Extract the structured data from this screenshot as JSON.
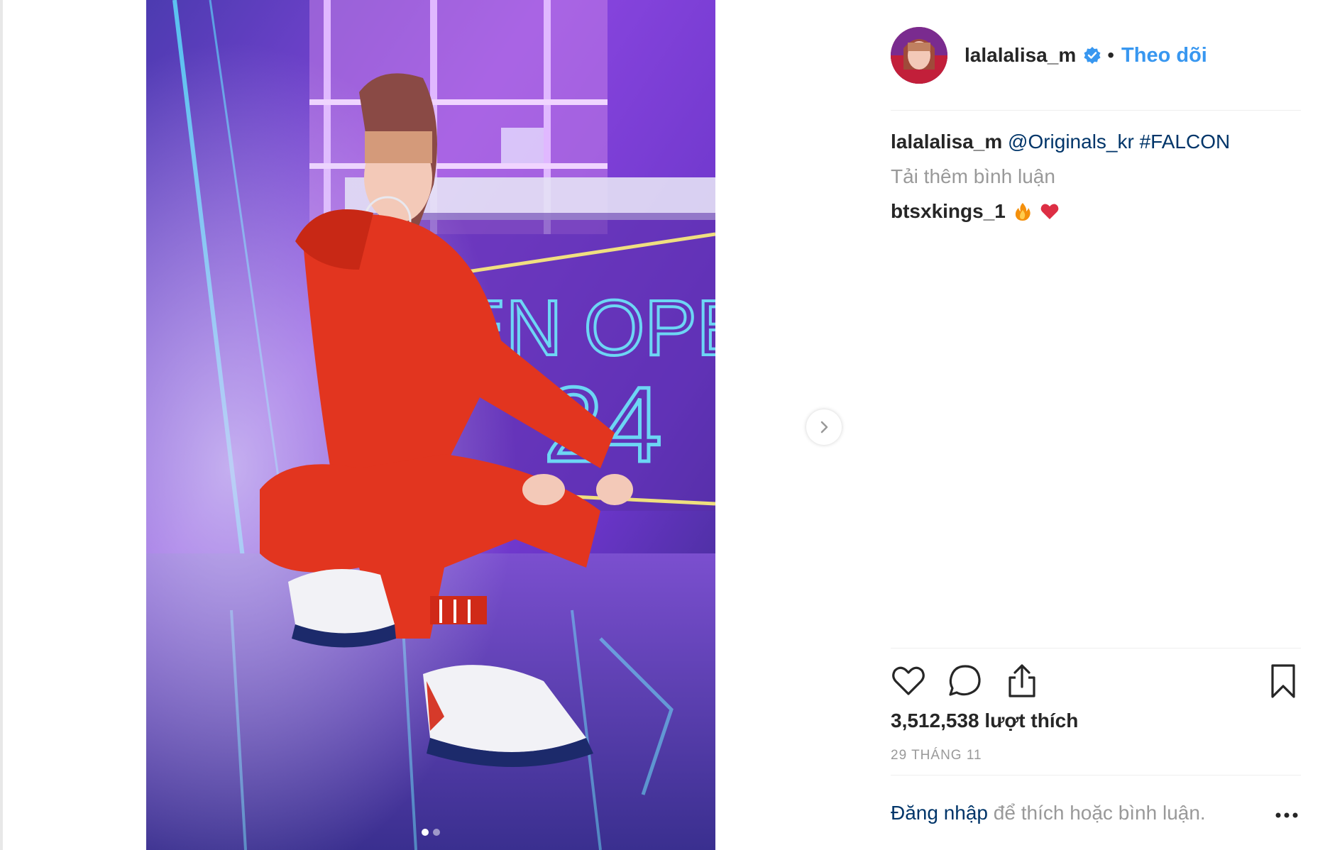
{
  "post": {
    "username": "lalalalisa_m",
    "separator": "•",
    "follow_label": "Theo dõi",
    "caption": {
      "username": "lalalalisa_m",
      "mention": "@Originals_kr",
      "hashtag": "#FALCON"
    },
    "load_more_label": "Tải thêm bình luận",
    "comments": [
      {
        "username": "btsxkings_1",
        "emojis": [
          "fire-emoji",
          "red-heart-emoji"
        ]
      }
    ],
    "likes_text": "3,512,538 lượt thích",
    "date_text": "29 THÁNG 11",
    "login_link": "Đăng nhập",
    "login_suffix": " để thích hoặc bình luận.",
    "carousel": {
      "total": 2,
      "current": 1
    }
  },
  "icons": {
    "verified": "verified-badge-icon",
    "next": "chevron-right-icon",
    "like": "heart-icon",
    "comment": "comment-bubble-icon",
    "share": "share-icon",
    "save": "bookmark-icon",
    "more": "more-options-icon"
  },
  "colors": {
    "link_blue": "#3897f0",
    "tag_blue": "#003569",
    "muted": "#999999",
    "text": "#262626"
  }
}
